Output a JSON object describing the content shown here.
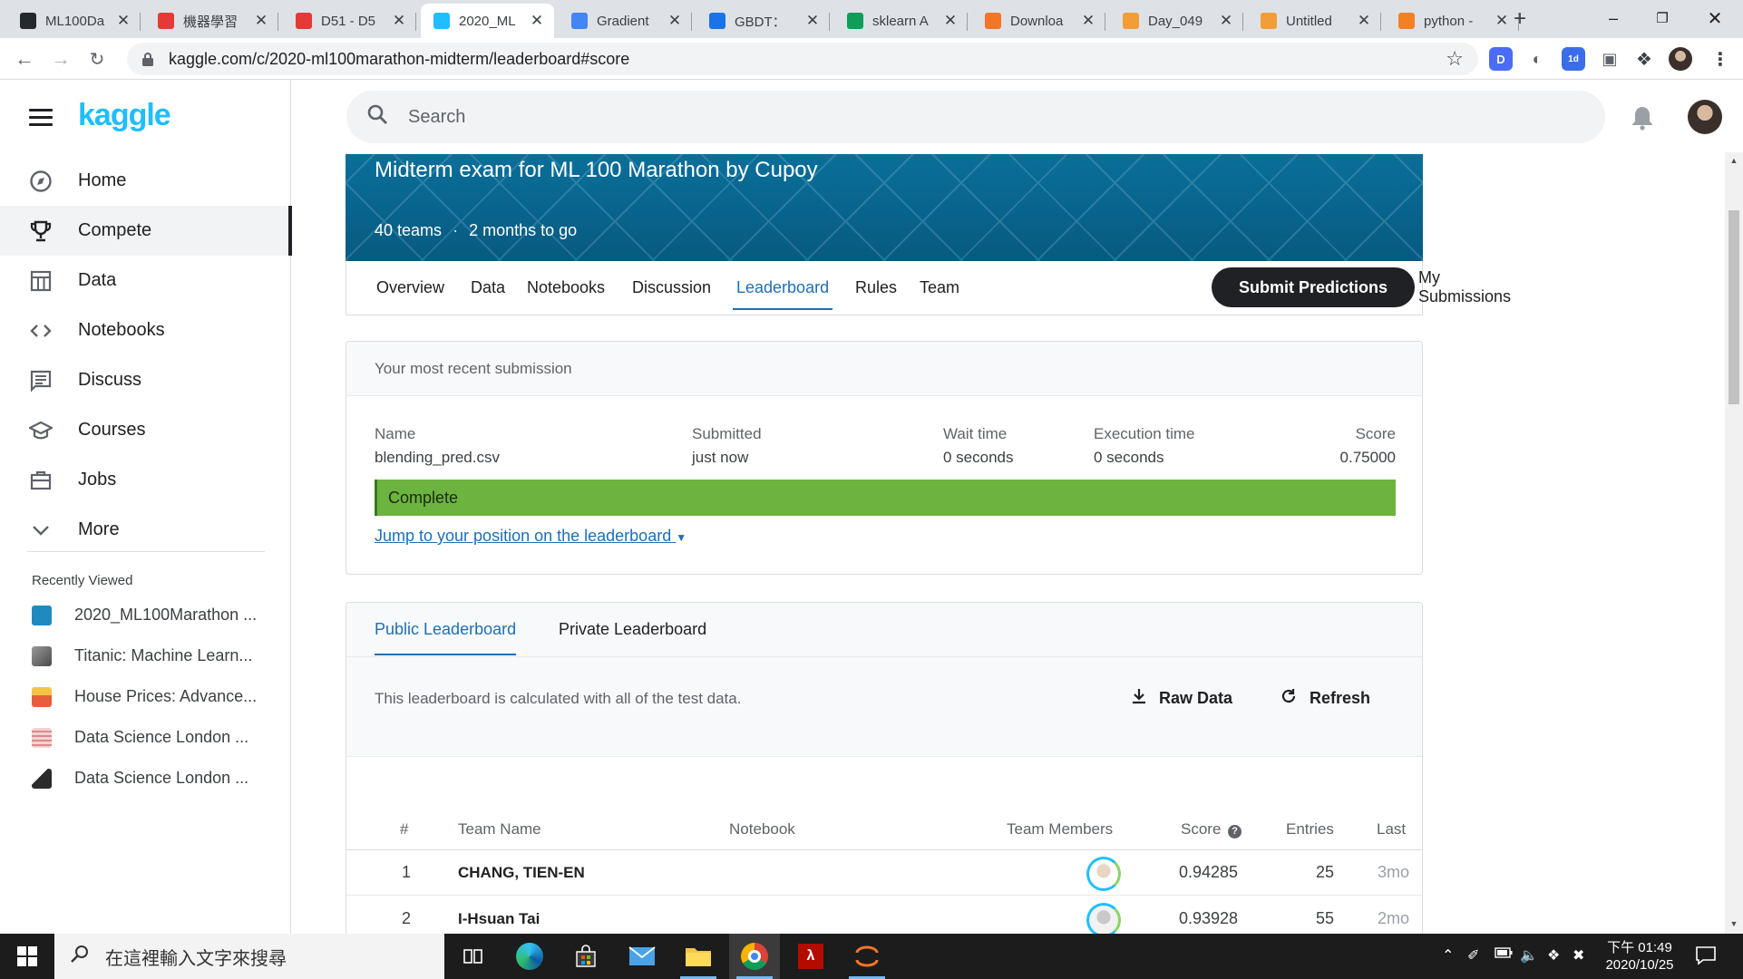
{
  "browser": {
    "tabs": [
      {
        "title": "ML100Da",
        "icon": "github-icon",
        "color": "#24292e"
      },
      {
        "title": "機器學習",
        "icon": "cupoy-icon",
        "color": "#e53935"
      },
      {
        "title": "D51 - D5",
        "icon": "cupoy-icon",
        "color": "#e53935"
      },
      {
        "title": "2020_ML",
        "icon": "kaggle-icon",
        "color": "#20beff"
      },
      {
        "title": "Gradient",
        "icon": "chart-icon",
        "color": "#4285f4"
      },
      {
        "title": "GBDT：",
        "icon": "doc-icon",
        "color": "#1a73e8"
      },
      {
        "title": "sklearn A",
        "icon": "sklearn-icon",
        "color": "#0f9d58"
      },
      {
        "title": "Downloa",
        "icon": "jupyter-icon",
        "color": "#f37626"
      },
      {
        "title": "Day_049",
        "icon": "notebook-icon",
        "color": "#f29d38"
      },
      {
        "title": "Untitled",
        "icon": "notebook-icon",
        "color": "#f29d38"
      },
      {
        "title": "python -",
        "icon": "python-icon",
        "color": "#f48024"
      }
    ],
    "active_tab_index": 3,
    "url": "kaggle.com/c/2020-ml100marathon-midterm/leaderboard#score"
  },
  "sidebar": {
    "logo": "kaggle",
    "nav": [
      {
        "label": "Home",
        "icon": "compass-icon"
      },
      {
        "label": "Compete",
        "icon": "trophy-icon",
        "active": true
      },
      {
        "label": "Data",
        "icon": "table-icon"
      },
      {
        "label": "Notebooks",
        "icon": "code-icon"
      },
      {
        "label": "Discuss",
        "icon": "comment-icon"
      },
      {
        "label": "Courses",
        "icon": "graduation-cap-icon"
      },
      {
        "label": "Jobs",
        "icon": "briefcase-icon"
      },
      {
        "label": "More",
        "icon": "chevron-down-icon"
      }
    ],
    "recently_viewed_label": "Recently Viewed",
    "recent": [
      {
        "label": "2020_ML100Marathon ...",
        "color": "#1f8ac0"
      },
      {
        "label": "Titanic: Machine Learn...",
        "color": "#6b6b6b"
      },
      {
        "label": "House Prices: Advance...",
        "color": "#e85d3a"
      },
      {
        "label": "Data Science London ...",
        "color": "#d9a0a0"
      },
      {
        "label": "Data Science London ...",
        "color": "#2b2b2b"
      }
    ]
  },
  "header": {
    "search_placeholder": "Search"
  },
  "competition": {
    "title": "Midterm exam for ML 100 Marathon by Cupoy",
    "teams": "40 teams",
    "separator": "·",
    "deadline": "2 months to go",
    "tabs": [
      "Overview",
      "Data",
      "Notebooks",
      "Discussion",
      "Leaderboard",
      "Rules",
      "Team"
    ],
    "active_tab": "Leaderboard",
    "my_submissions": "My Submissions",
    "submit_button": "Submit Predictions"
  },
  "recent_submission": {
    "heading": "Your most recent submission",
    "columns": [
      {
        "label": "Name",
        "value": "blending_pred.csv"
      },
      {
        "label": "Submitted",
        "value": "just now"
      },
      {
        "label": "Wait time",
        "value": "0 seconds"
      },
      {
        "label": "Execution time",
        "value": "0 seconds"
      },
      {
        "label": "Score",
        "value": "0.75000"
      }
    ],
    "status": "Complete",
    "status_color": "#6db33f",
    "jump_link": "Jump to your position on the leaderboard"
  },
  "leaderboard": {
    "tabs": [
      "Public Leaderboard",
      "Private Leaderboard"
    ],
    "active_tab": "Public Leaderboard",
    "info": "This leaderboard is calculated with all of the test data.",
    "raw_data": "Raw Data",
    "refresh": "Refresh",
    "headers": {
      "rank": "#",
      "team": "Team Name",
      "notebook": "Notebook",
      "members": "Team Members",
      "score": "Score",
      "entries": "Entries",
      "last": "Last"
    },
    "rows": [
      {
        "rank": "1",
        "team": "CHANG, TIEN-EN",
        "score": "0.94285",
        "entries": "25",
        "last": "3mo"
      },
      {
        "rank": "2",
        "team": "I-Hsuan Tai",
        "score": "0.93928",
        "entries": "55",
        "last": "2mo"
      }
    ]
  },
  "taskbar": {
    "search_placeholder": "在這裡輸入文字來搜尋",
    "time": "下午 01:49",
    "date": "2020/10/25"
  }
}
